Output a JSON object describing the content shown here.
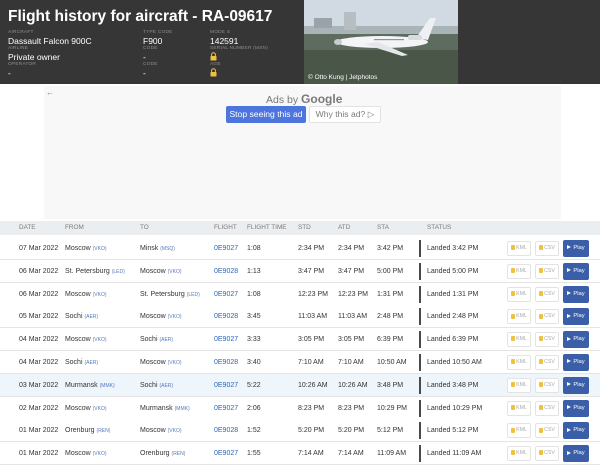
{
  "page_title": "Flight history for aircraft - RA-09617",
  "aircraft": {
    "aircraft_label": "AIRCRAFT",
    "aircraft_value": "Dassault Falcon 900C",
    "type_code_label": "TYPE CODE",
    "type_code_value": "F900",
    "mode_s_label": "MODE S",
    "mode_s_value": "142591",
    "airline_label": "AIRLINE",
    "airline_value": "Private owner",
    "code_label": "Code",
    "code_value": "-",
    "msn_label": "SERIAL NUMBER (MSN)",
    "msn_value": "locked",
    "operator_label": "OPERATOR",
    "operator_value": "-",
    "code2_label": "Code",
    "code2_value": "-",
    "age_label": "AGE",
    "age_value": "locked"
  },
  "photo_credit": "© Otto Kung | Jetphotos",
  "ad": {
    "back_icon": "back-arrow-icon",
    "ads_by": "Ads by",
    "brand": "Google",
    "stop_label": "Stop seeing this ad",
    "why_label": "Why this ad? ▷"
  },
  "table": {
    "headers": [
      "DATE",
      "FROM",
      "TO",
      "FLIGHT",
      "FLIGHT TIME",
      "STD",
      "ATD",
      "STA",
      "STATUS"
    ],
    "kml_label": "KML",
    "csv_label": "CSV",
    "play_label": "Play",
    "highlight_color": "#eef5fb",
    "rows": [
      {
        "date": "07 Mar 2022",
        "from": "Moscow",
        "from_code": "(VKO)",
        "to": "Minsk",
        "to_code": "(MSQ)",
        "flight": "0E9027",
        "flight_time": "1:08",
        "std": "2:34 PM",
        "atd": "2:34 PM",
        "sta": "3:42 PM",
        "status": "Landed 3:42 PM"
      },
      {
        "date": "06 Mar 2022",
        "from": "St. Petersburg",
        "from_code": "(LED)",
        "to": "Moscow",
        "to_code": "(VKO)",
        "flight": "0E9028",
        "flight_time": "1:13",
        "std": "3:47 PM",
        "atd": "3:47 PM",
        "sta": "5:00 PM",
        "status": "Landed 5:00 PM"
      },
      {
        "date": "06 Mar 2022",
        "from": "Moscow",
        "from_code": "(VKO)",
        "to": "St. Petersburg",
        "to_code": "(LED)",
        "flight": "0E9027",
        "flight_time": "1:08",
        "std": "12:23 PM",
        "atd": "12:23 PM",
        "sta": "1:31 PM",
        "status": "Landed 1:31 PM"
      },
      {
        "date": "05 Mar 2022",
        "from": "Sochi",
        "from_code": "(AER)",
        "to": "Moscow",
        "to_code": "(VKO)",
        "flight": "0E9028",
        "flight_time": "3:45",
        "std": "11:03 AM",
        "atd": "11:03 AM",
        "sta": "2:48 PM",
        "status": "Landed 2:48 PM"
      },
      {
        "date": "04 Mar 2022",
        "from": "Moscow",
        "from_code": "(VKO)",
        "to": "Sochi",
        "to_code": "(AER)",
        "flight": "0E9027",
        "flight_time": "3:33",
        "std": "3:05 PM",
        "atd": "3:05 PM",
        "sta": "6:39 PM",
        "status": "Landed 6:39 PM"
      },
      {
        "date": "04 Mar 2022",
        "from": "Sochi",
        "from_code": "(AER)",
        "to": "Moscow",
        "to_code": "(VKO)",
        "flight": "0E9028",
        "flight_time": "3:40",
        "std": "7:10 AM",
        "atd": "7:10 AM",
        "sta": "10:50 AM",
        "status": "Landed 10:50 AM"
      },
      {
        "date": "03 Mar 2022",
        "from": "Murmansk",
        "from_code": "(MMK)",
        "to": "Sochi",
        "to_code": "(AER)",
        "flight": "0E9027",
        "flight_time": "5:22",
        "std": "10:26 AM",
        "atd": "10:26 AM",
        "sta": "3:48 PM",
        "status": "Landed 3:48 PM",
        "highlight": true
      },
      {
        "date": "02 Mar 2022",
        "from": "Moscow",
        "from_code": "(VKO)",
        "to": "Murmansk",
        "to_code": "(MMK)",
        "flight": "0E9027",
        "flight_time": "2:06",
        "std": "8:23 PM",
        "atd": "8:23 PM",
        "sta": "10:29 PM",
        "status": "Landed 10:29 PM"
      },
      {
        "date": "01 Mar 2022",
        "from": "Orenburg",
        "from_code": "(REN)",
        "to": "Moscow",
        "to_code": "(VKO)",
        "flight": "0E9028",
        "flight_time": "1:52",
        "std": "5:20 PM",
        "atd": "5:20 PM",
        "sta": "5:12 PM",
        "status": "Landed 5:12 PM"
      },
      {
        "date": "01 Mar 2022",
        "from": "Moscow",
        "from_code": "(VKO)",
        "to": "Orenburg",
        "to_code": "(REN)",
        "flight": "0E9027",
        "flight_time": "1:55",
        "std": "7:14 AM",
        "atd": "7:14 AM",
        "sta": "11:09 AM",
        "status": "Landed 11:09 AM"
      }
    ]
  }
}
